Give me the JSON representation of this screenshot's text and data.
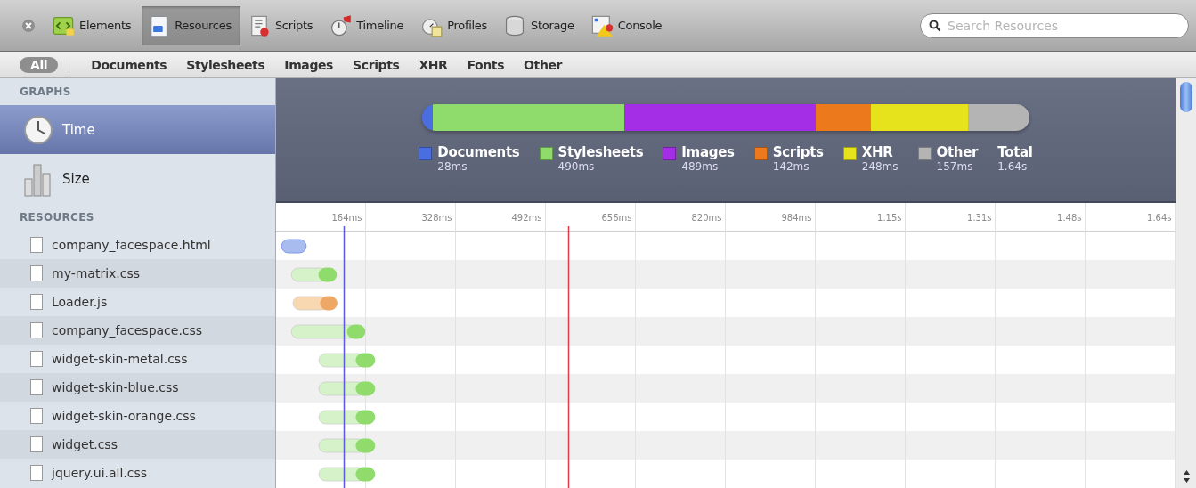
{
  "toolbar": {
    "items": [
      {
        "label": "Elements",
        "selected": false
      },
      {
        "label": "Resources",
        "selected": true
      },
      {
        "label": "Scripts",
        "selected": false
      },
      {
        "label": "Timeline",
        "selected": false
      },
      {
        "label": "Profiles",
        "selected": false
      },
      {
        "label": "Storage",
        "selected": false
      },
      {
        "label": "Console",
        "selected": false
      }
    ],
    "search": {
      "placeholder": "Search Resources"
    }
  },
  "filters": [
    {
      "label": "All",
      "selected": true
    },
    {
      "label": "Documents",
      "selected": false
    },
    {
      "label": "Stylesheets",
      "selected": false
    },
    {
      "label": "Images",
      "selected": false
    },
    {
      "label": "Scripts",
      "selected": false
    },
    {
      "label": "XHR",
      "selected": false
    },
    {
      "label": "Fonts",
      "selected": false
    },
    {
      "label": "Other",
      "selected": false
    }
  ],
  "sidebar": {
    "graphs_heading": "GRAPHS",
    "graphs": [
      {
        "label": "Time",
        "selected": true
      },
      {
        "label": "Size",
        "selected": false
      }
    ],
    "resources_heading": "RESOURCES",
    "resources": [
      {
        "name": "company_facespace.html",
        "kind": "document"
      },
      {
        "name": "my-matrix.css",
        "kind": "stylesheet"
      },
      {
        "name": "Loader.js",
        "kind": "script"
      },
      {
        "name": "company_facespace.css",
        "kind": "stylesheet"
      },
      {
        "name": "widget-skin-metal.css",
        "kind": "stylesheet"
      },
      {
        "name": "widget-skin-blue.css",
        "kind": "stylesheet"
      },
      {
        "name": "widget-skin-orange.css",
        "kind": "stylesheet"
      },
      {
        "name": "widget.css",
        "kind": "stylesheet"
      },
      {
        "name": "jquery.ui.all.css",
        "kind": "stylesheet"
      }
    ]
  },
  "summary": {
    "categories": [
      {
        "name": "Documents",
        "value": "28ms",
        "color": "#4a6ee0"
      },
      {
        "name": "Stylesheets",
        "value": "490ms",
        "color": "#8fdc6c"
      },
      {
        "name": "Images",
        "value": "489ms",
        "color": "#a42ee6"
      },
      {
        "name": "Scripts",
        "value": "142ms",
        "color": "#ec7a1c"
      },
      {
        "name": "XHR",
        "value": "248ms",
        "color": "#e6e21c"
      },
      {
        "name": "Other",
        "value": "157ms",
        "color": "#b4b4b4"
      }
    ],
    "total": {
      "name": "Total",
      "value": "1.64s"
    }
  },
  "timeline": {
    "tick_labels": [
      "164ms",
      "328ms",
      "492ms",
      "656ms",
      "820ms",
      "984ms",
      "1.15s",
      "1.31s",
      "1.48s",
      "1.64s"
    ]
  }
}
